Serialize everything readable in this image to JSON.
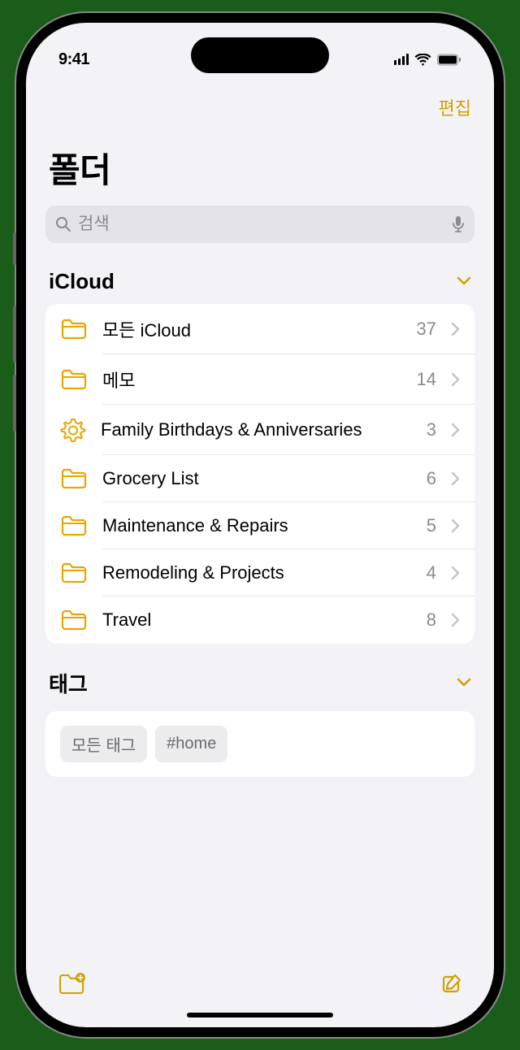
{
  "status": {
    "time": "9:41"
  },
  "nav": {
    "edit": "편집"
  },
  "page": {
    "title": "폴더"
  },
  "search": {
    "placeholder": "검색"
  },
  "sections": {
    "icloud": {
      "title": "iCloud",
      "folders": [
        {
          "name": "모든 iCloud",
          "count": "37",
          "icon": "folder"
        },
        {
          "name": "메모",
          "count": "14",
          "icon": "folder"
        },
        {
          "name": "Family Birthdays & Anniversaries",
          "count": "3",
          "icon": "gear"
        },
        {
          "name": "Grocery List",
          "count": "6",
          "icon": "folder"
        },
        {
          "name": "Maintenance & Repairs",
          "count": "5",
          "icon": "folder"
        },
        {
          "name": "Remodeling & Projects",
          "count": "4",
          "icon": "folder"
        },
        {
          "name": "Travel",
          "count": "8",
          "icon": "folder"
        }
      ]
    },
    "tags": {
      "title": "태그",
      "items": [
        {
          "label": "모든 태그"
        },
        {
          "label": "#home"
        }
      ]
    }
  },
  "colors": {
    "accent": "#d3a000",
    "folder_icon": "#e8a600",
    "bg": "#f2f2f7",
    "card": "#ffffff",
    "secondary_text": "#8a8a8e",
    "divider": "#e9e9eb"
  }
}
